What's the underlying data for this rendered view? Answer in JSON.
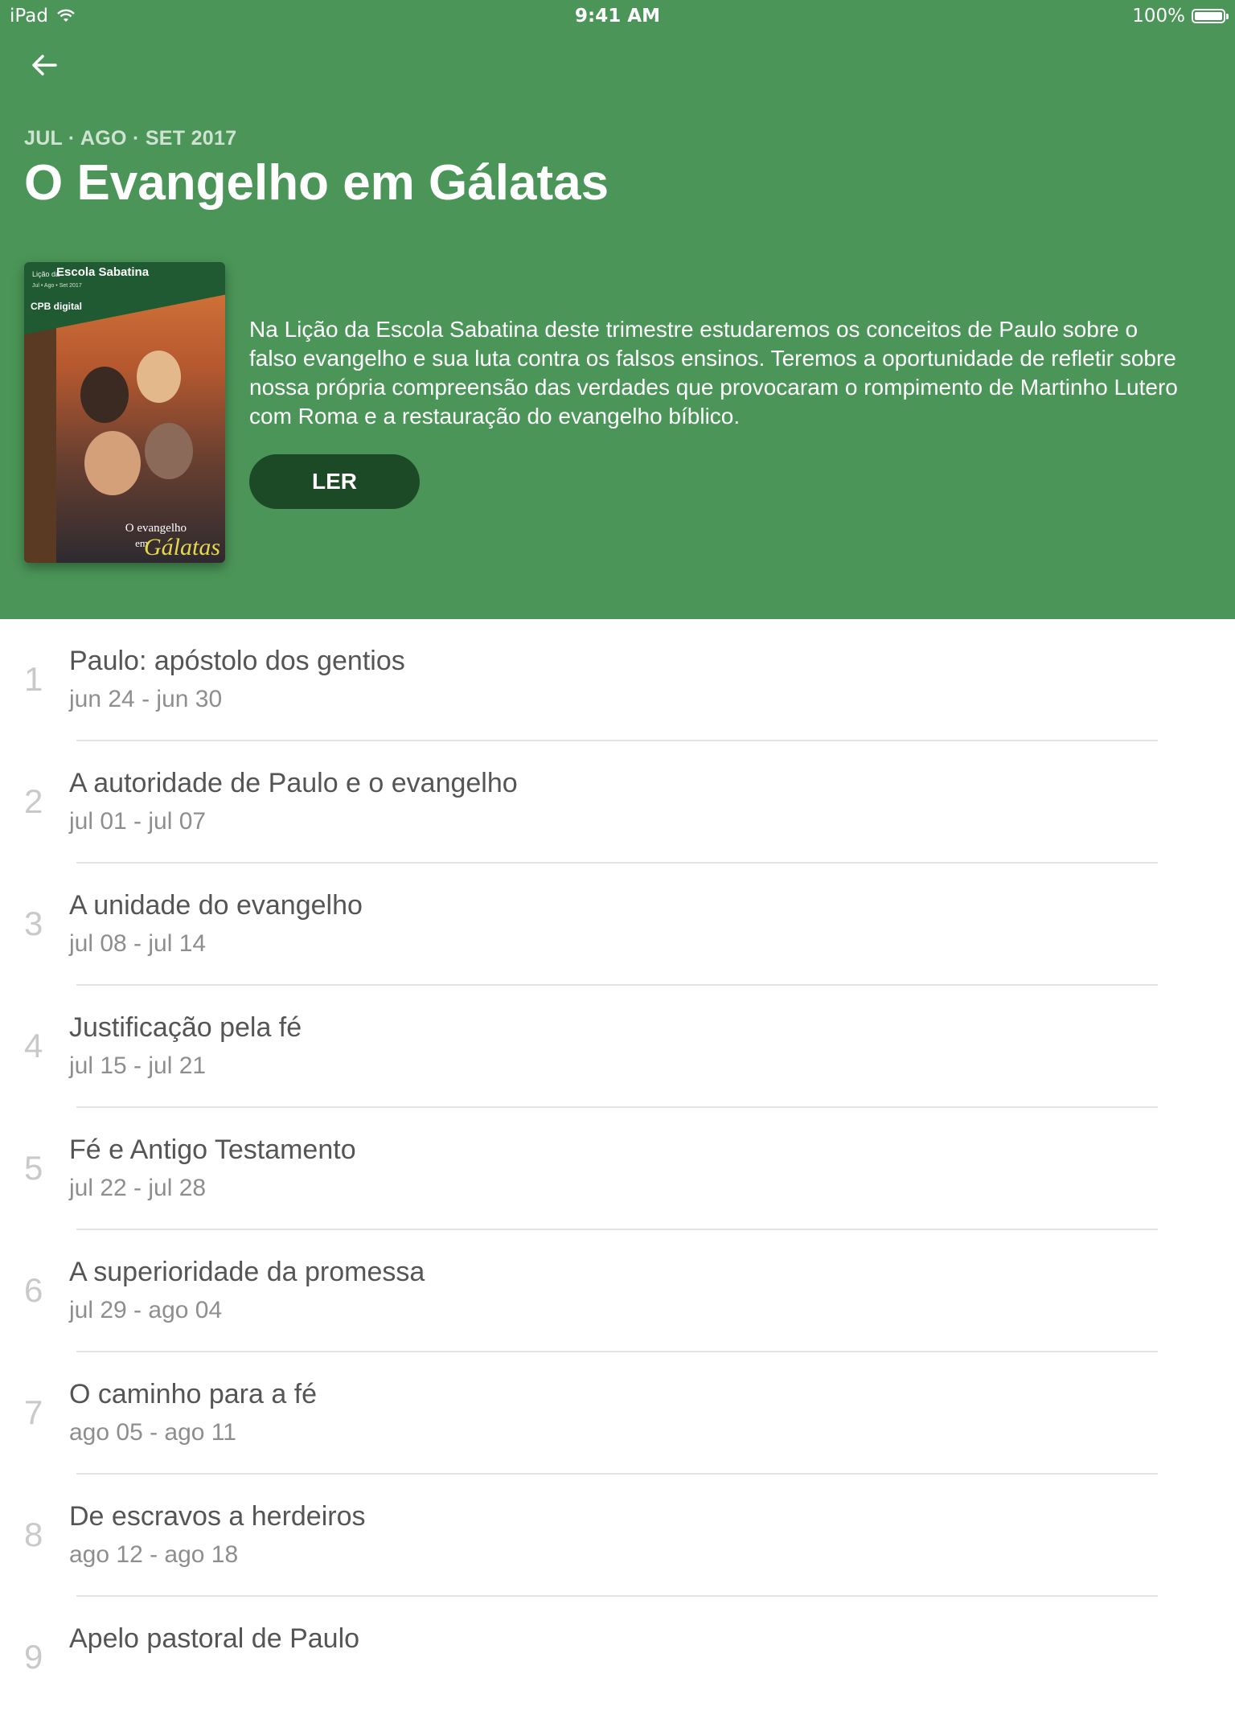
{
  "status_bar": {
    "device": "iPad",
    "time": "9:41 AM",
    "battery": "100%"
  },
  "header": {
    "back_icon": "arrow-left-icon",
    "quarter": "JUL · AGO · SET 2017",
    "title": "O Evangelho em Gálatas",
    "description": "Na Lição da Escola Sabatina deste trimestre estudaremos os conceitos de Paulo sobre o falso evangelho e sua luta contra os falsos ensinos. Teremos a oportunidade de refletir sobre nossa própria compreensão das verdades que provocaram o rompimento de Martinho Lutero com Roma e a restauração do evangelho bíblico.",
    "read_label": "LER",
    "background_color": "#4b9558",
    "button_color": "#1d4a26"
  },
  "cover": {
    "small": "Lição da",
    "series": "Escola Sabatina",
    "dates": "Jul • Ago • Set 2017",
    "logo": "CPB digital",
    "title_line1": "O evangelho",
    "title_em": "em",
    "title_big": "Gálatas"
  },
  "lessons": [
    {
      "number": "1",
      "title": "Paulo: apóstolo dos gentios",
      "dates": "jun 24 - jun 30"
    },
    {
      "number": "2",
      "title": "A autoridade de Paulo e o evangelho",
      "dates": "jul 01 - jul 07"
    },
    {
      "number": "3",
      "title": "A unidade do evangelho",
      "dates": "jul 08 - jul 14"
    },
    {
      "number": "4",
      "title": "Justificação pela fé",
      "dates": "jul 15 - jul 21"
    },
    {
      "number": "5",
      "title": "Fé e Antigo Testamento",
      "dates": "jul 22 - jul 28"
    },
    {
      "number": "6",
      "title": "A superioridade da promessa",
      "dates": "jul 29 - ago 04"
    },
    {
      "number": "7",
      "title": "O caminho para a fé",
      "dates": "ago 05 - ago 11"
    },
    {
      "number": "8",
      "title": "De escravos a herdeiros",
      "dates": "ago 12 - ago 18"
    },
    {
      "number": "9",
      "title": "Apelo pastoral de Paulo",
      "dates": ""
    }
  ]
}
